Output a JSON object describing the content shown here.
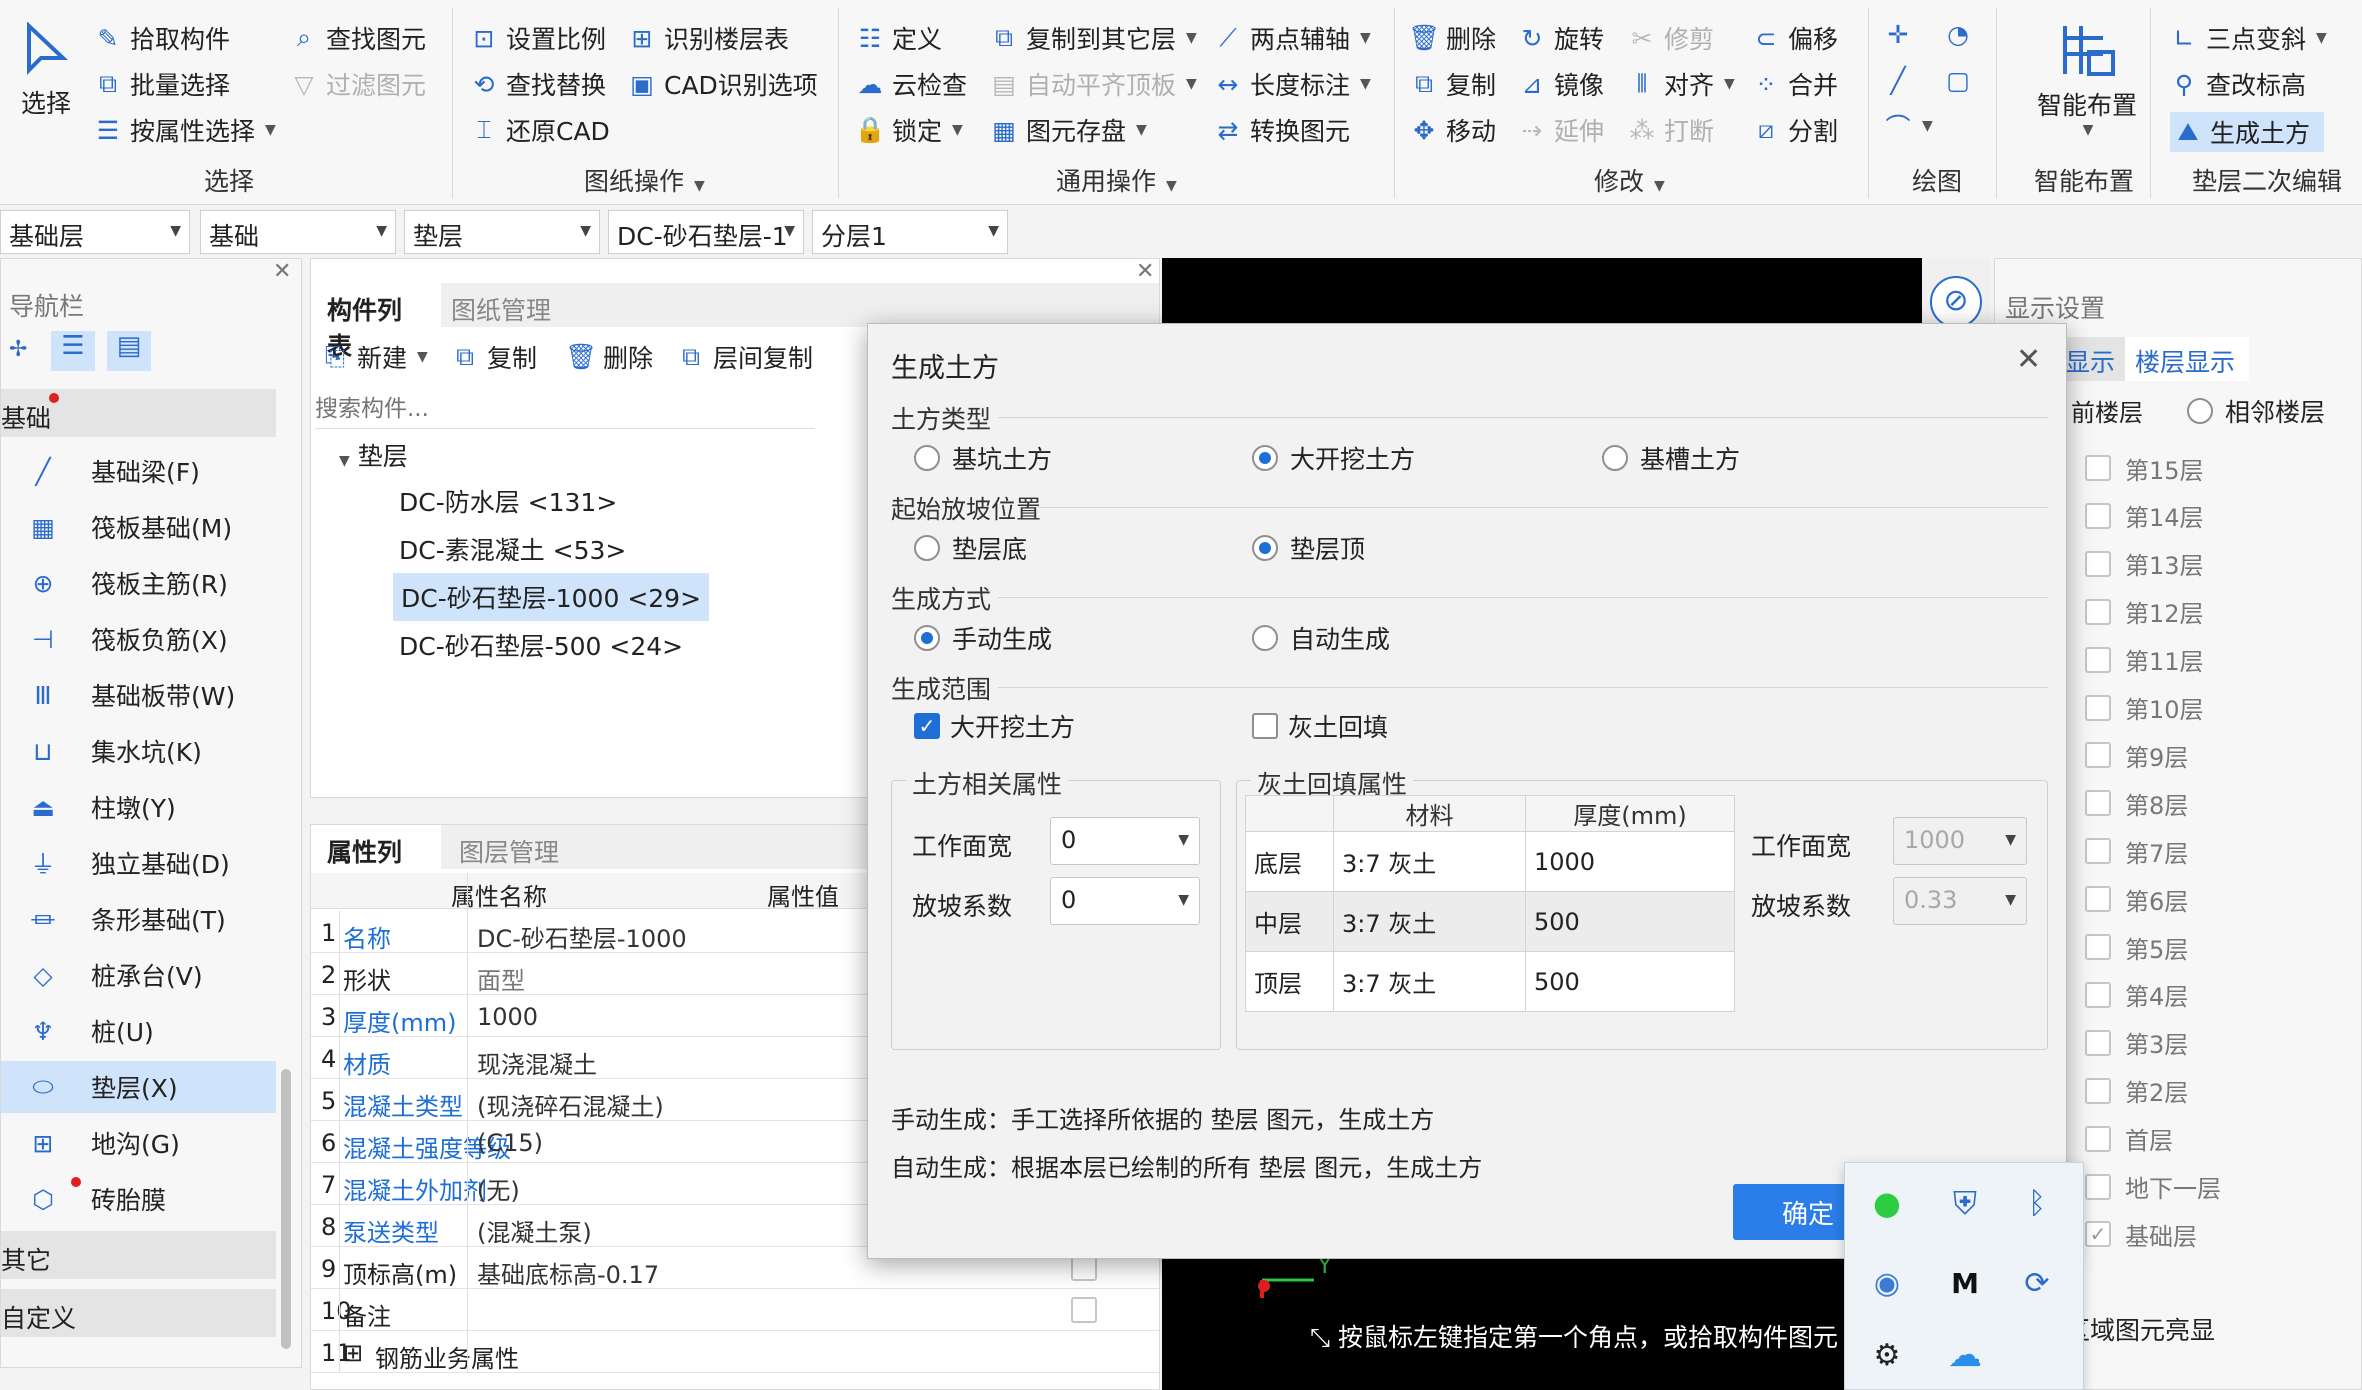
{
  "ribbon": {
    "select_big": "选择",
    "select_group": {
      "pick": "拾取构件",
      "batch": "批量选择",
      "by_attr": "按属性选择",
      "find": "查找图元",
      "filter": "过滤图元",
      "label": "选择"
    },
    "drawing_ops": {
      "scale": "设置比例",
      "find_replace": "查找替换",
      "restore_cad": "还原CAD",
      "identify_floor": "识别楼层表",
      "cad_options": "CAD识别选项",
      "label": "图纸操作"
    },
    "general_ops": {
      "define": "定义",
      "cloud_check": "云检查",
      "lock": "锁定",
      "copy_floor": "复制到其它层",
      "auto_flat": "自动平齐顶板",
      "store": "图元存盘",
      "two_axis": "两点辅轴",
      "length_dim": "长度标注",
      "convert": "转换图元",
      "label": "通用操作"
    },
    "modify": {
      "delete": "删除",
      "copy": "复制",
      "move": "移动",
      "rotate": "旋转",
      "mirror": "镜像",
      "extend": "延伸",
      "trim": "修剪",
      "align": "对齐",
      "break": "打断",
      "offset": "偏移",
      "merge": "合并",
      "split": "分割",
      "label": "修改"
    },
    "draw": {
      "label": "绘图"
    },
    "smart": {
      "big": "智能布置",
      "label": "智能布置"
    },
    "cushion_edit": {
      "slope": "三点变斜",
      "check_elev": "查改标高",
      "gen_earth": "生成土方",
      "label": "垫层二次编辑"
    }
  },
  "filters": {
    "floor": "基础层",
    "category": "基础",
    "type": "垫层",
    "component": "DC-砂石垫层-1",
    "sublayer": "分层1"
  },
  "nav": {
    "title": "导航栏",
    "group1": "基础",
    "items": [
      "基础梁(F)",
      "筏板基础(M)",
      "筏板主筋(R)",
      "筏板负筋(X)",
      "基础板带(W)",
      "集水坑(K)",
      "柱墩(Y)",
      "独立基础(D)",
      "条形基础(T)",
      "桩承台(V)",
      "桩(U)",
      "垫层(X)",
      "地沟(G)",
      "砖胎膜"
    ],
    "group2": "其它",
    "group3": "自定义"
  },
  "component_list": {
    "tab_active": "构件列表",
    "tab_other": "图纸管理",
    "toolbar": {
      "new": "新建",
      "copy": "复制",
      "delete": "删除",
      "floor_copy": "层间复制"
    },
    "search_placeholder": "搜索构件...",
    "root": "垫层",
    "items": [
      "DC-防水层 <131>",
      "DC-素混凝土 <53>",
      "DC-砂石垫层-1000 <29>",
      "DC-砂石垫层-500 <24>"
    ]
  },
  "properties": {
    "tab_active": "属性列表",
    "tab_other": "图层管理",
    "col_name": "属性名称",
    "col_value": "属性值",
    "rows": [
      {
        "no": "1",
        "name": "名称",
        "value": "DC-砂石垫层-1000"
      },
      {
        "no": "2",
        "name": "形状",
        "value": "面型"
      },
      {
        "no": "3",
        "name": "厚度(mm)",
        "value": "1000"
      },
      {
        "no": "4",
        "name": "材质",
        "value": "现浇混凝土"
      },
      {
        "no": "5",
        "name": "混凝土类型",
        "value": "(现浇碎石混凝土)"
      },
      {
        "no": "6",
        "name": "混凝土强度等级",
        "value": "(C15)"
      },
      {
        "no": "7",
        "name": "混凝土外加剂",
        "value": "(无)"
      },
      {
        "no": "8",
        "name": "泵送类型",
        "value": "(混凝土泵)"
      },
      {
        "no": "9",
        "name": "顶标高(m)",
        "value": "基础底标高-0.17"
      },
      {
        "no": "10",
        "name": "备注",
        "value": ""
      },
      {
        "no": "11",
        "name": "钢筋业务属性",
        "value": ""
      }
    ]
  },
  "display_settings": {
    "title": "显示设置",
    "tab1": "显示",
    "tab2": "楼层显示",
    "opt_current": "前楼层",
    "opt_adjacent": "相邻楼层",
    "floors": [
      "第15层",
      "第14层",
      "第13层",
      "第12层",
      "第11层",
      "第10层",
      "第9层",
      "第8层",
      "第7层",
      "第6层",
      "第5层",
      "第4层",
      "第3层",
      "第2层",
      "首层",
      "地下一层",
      "基础层"
    ],
    "footer": "区域图元亮显"
  },
  "viewport": {
    "status_hint": "按鼠标左键指定第一个角点，或拾取构件图元",
    "axis_y": "Y"
  },
  "dialog": {
    "title": "生成土方",
    "earth_type": {
      "label": "土方类型",
      "opt1": "基坑土方",
      "opt2": "大开挖土方",
      "opt3": "基槽土方",
      "selected": "大开挖土方"
    },
    "slope_start": {
      "label": "起始放坡位置",
      "opt1": "垫层底",
      "opt2": "垫层顶",
      "selected": "垫层顶"
    },
    "gen_mode": {
      "label": "生成方式",
      "opt1": "手动生成",
      "opt2": "自动生成",
      "selected": "手动生成"
    },
    "gen_range": {
      "label": "生成范围",
      "opt1": "大开挖土方",
      "opt2": "灰土回填"
    },
    "earth_props": {
      "label": "土方相关属性",
      "work_width_label": "工作面宽",
      "work_width": "0",
      "slope_label": "放坡系数",
      "slope": "0"
    },
    "fill_props": {
      "label": "灰土回填属性",
      "col_material": "材料",
      "col_thickness": "厚度(mm)",
      "rows": [
        {
          "layer": "底层",
          "material": "3:7 灰土",
          "thickness": "1000"
        },
        {
          "layer": "中层",
          "material": "3:7 灰土",
          "thickness": "500"
        },
        {
          "layer": "顶层",
          "material": "3:7 灰土",
          "thickness": "500"
        }
      ],
      "work_width_label": "工作面宽",
      "work_width": "1000",
      "slope_label": "放坡系数",
      "slope": "0.33"
    },
    "note_manual": "手动生成：手工选择所依据的 垫层 图元，生成土方",
    "note_auto": "自动生成：根据本层已绘制的所有 垫层 图元，生成土方",
    "ok_label": "确定"
  },
  "colors": {
    "accent": "#1d6fd6",
    "button": "#2b7de9",
    "viewport": "#000000"
  }
}
